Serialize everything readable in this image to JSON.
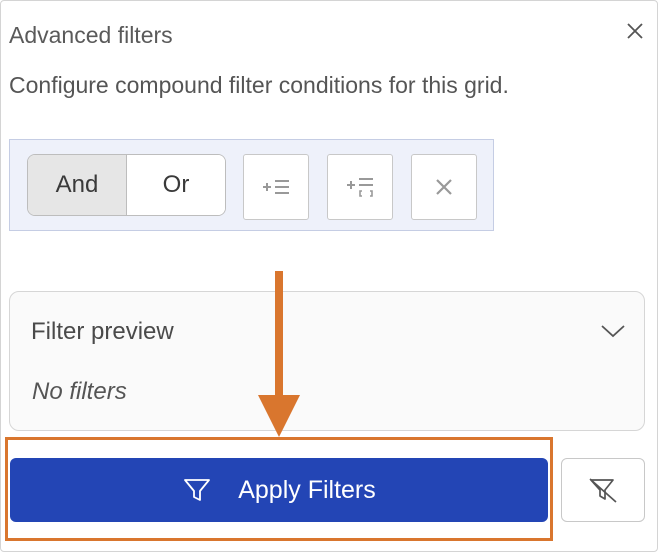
{
  "panel": {
    "title": "Advanced filters",
    "description": "Configure compound filter conditions for this grid."
  },
  "toolbar": {
    "logic_options": [
      "And",
      "Or"
    ],
    "selected_logic": "And",
    "buttons": [
      {
        "icon": "add-condition-icon"
      },
      {
        "icon": "add-group-icon"
      },
      {
        "icon": "remove-icon"
      }
    ]
  },
  "preview": {
    "title": "Filter preview",
    "empty_text": "No filters"
  },
  "actions": {
    "apply_label": "Apply Filters",
    "clear_icon": "clear-filter-icon"
  },
  "colors": {
    "primary": "#2345b5",
    "annotation": "#d9762e",
    "toolbar_bg": "#eef1fa"
  }
}
